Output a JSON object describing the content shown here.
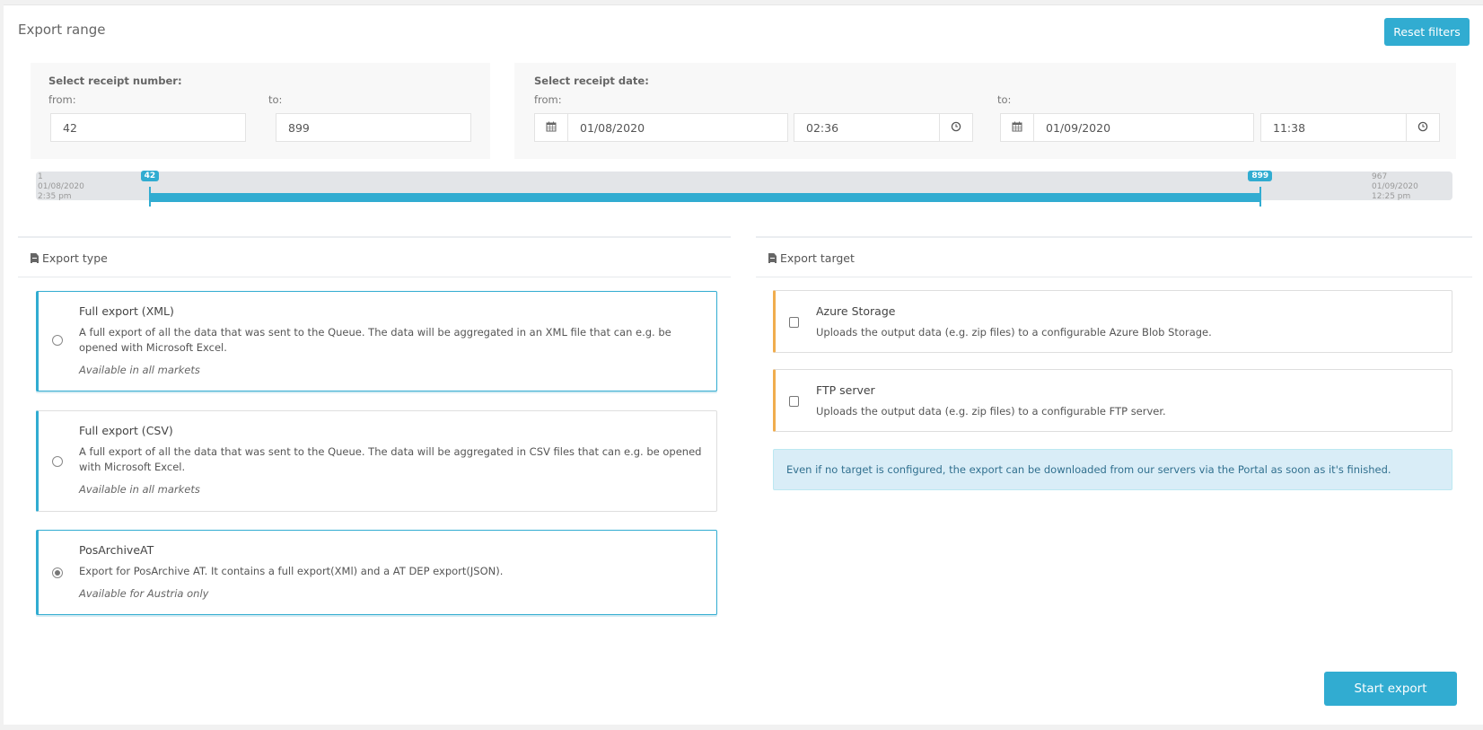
{
  "export_range": {
    "title": "Export range",
    "reset_button": "Reset filters",
    "receipt_number": {
      "label": "Select receipt number:",
      "from_label": "from:",
      "to_label": "to:",
      "from_value": "42",
      "to_value": "899"
    },
    "receipt_date": {
      "label": "Select receipt date:",
      "from_label": "from:",
      "to_label": "to:",
      "from_date": "01/08/2020",
      "from_time": "02:36",
      "to_date": "01/09/2020",
      "to_time": "11:38",
      "calendar_icon": "calendar-icon",
      "clock_icon": "clock-icon"
    },
    "slider": {
      "min": 1,
      "max": 967,
      "from": 42,
      "to": 899,
      "min_label": "1",
      "min_date": "01/08/2020 2:35 pm",
      "max_label": "967",
      "max_date": "01/09/2020 12:25 pm",
      "from_tag": "42",
      "to_tag": "899",
      "accent": "#31acd1"
    }
  },
  "export_type": {
    "header": "Export type",
    "header_icon": "file-icon",
    "options": [
      {
        "title": "Full export (XML)",
        "description": "A full export of all the data that was sent to the Queue. The data will be aggregated in an XML file that can e.g. be opened with Microsoft Excel.",
        "note": "Available in all markets",
        "selected": false
      },
      {
        "title": "Full export (CSV)",
        "description": "A full export of all the data that was sent to the Queue. The data will be aggregated in CSV files that can e.g. be opened with Microsoft Excel.",
        "note": "Available in all markets",
        "selected": false
      },
      {
        "title": "PosArchiveAT",
        "description": "Export for PosArchive AT. It contains a full export(XMl) and a AT DEP export(JSON).",
        "note": "Available for Austria only",
        "selected": true
      }
    ]
  },
  "export_target": {
    "header": "Export target",
    "header_icon": "file-icon",
    "options": [
      {
        "title": "Azure Storage",
        "description": "Uploads the output data (e.g. zip files) to a configurable Azure Blob Storage.",
        "checked": false
      },
      {
        "title": "FTP server",
        "description": "Uploads the output data (e.g. zip files) to a configurable FTP server.",
        "checked": false
      }
    ],
    "info": "Even if no target is configured, the export can be downloaded from our servers via the Portal as soon as it's finished.",
    "accent_orange": "#f0ad4e"
  },
  "footer": {
    "start_button": "Start export"
  }
}
